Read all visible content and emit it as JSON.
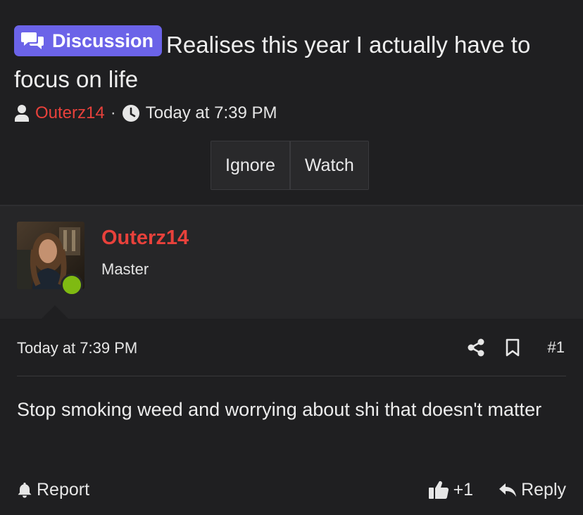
{
  "thread": {
    "prefix": "Discussion",
    "title": "Realises this year I actually have to focus on life",
    "author": "Outerz14",
    "separator": "·",
    "time": "Today at 7:39 PM",
    "buttons": {
      "ignore": "Ignore",
      "watch": "Watch"
    }
  },
  "post": {
    "user": {
      "name": "Outerz14",
      "title": "Master",
      "online": true
    },
    "date": "Today at 7:39 PM",
    "number": "#1",
    "message": "Stop smoking weed and worrying about shi that doesn't matter",
    "actions": {
      "report": "Report",
      "like_count": "+1",
      "reply": "Reply"
    }
  },
  "colors": {
    "background": "#1f1f21",
    "user_panel": "#262628",
    "prefix_badge": "#6b63e8",
    "username": "#e8413b",
    "online_indicator": "#7fba12"
  },
  "icons": {
    "prefix": "chat-bubbles-icon",
    "author": "user-icon",
    "time": "clock-icon",
    "share": "share-icon",
    "bookmark": "bookmark-icon",
    "report": "bell-icon",
    "like": "thumbs-up-icon",
    "reply": "reply-icon"
  }
}
